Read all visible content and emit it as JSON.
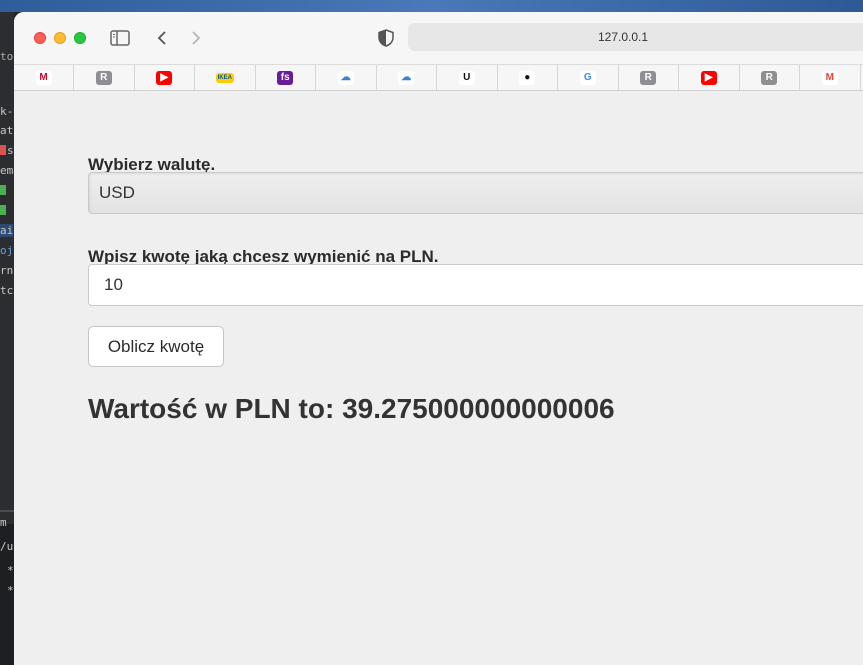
{
  "browser": {
    "address": "127.0.0.1",
    "favorites": [
      {
        "icon": "mbank-icon",
        "glyph": "M",
        "bg": "#ffffff",
        "fg": "#c8102e"
      },
      {
        "icon": "r-bookmark-icon",
        "glyph": "R",
        "bg": "#8e8e93",
        "fg": "#ffffff"
      },
      {
        "icon": "youtube-icon",
        "glyph": "▶",
        "bg": "#ff0000",
        "fg": "#ffffff"
      },
      {
        "icon": "ikea-icon",
        "glyph": "IKEA",
        "bg": "#ffcc00",
        "fg": "#0058a3"
      },
      {
        "icon": "fs-icon",
        "glyph": "fs",
        "bg": "#6a1b9a",
        "fg": "#ffffff"
      },
      {
        "icon": "cloud-face-icon",
        "glyph": "☁",
        "bg": "#ffffff",
        "fg": "#3b82d6"
      },
      {
        "icon": "cloud-face-icon-2",
        "glyph": "☁",
        "bg": "#ffffff",
        "fg": "#3b82d6"
      },
      {
        "icon": "upwork-icon",
        "glyph": "U",
        "bg": "#ffffff",
        "fg": "#111111"
      },
      {
        "icon": "github-icon",
        "glyph": "●",
        "bg": "#ffffff",
        "fg": "#111111"
      },
      {
        "icon": "google-icon",
        "glyph": "G",
        "bg": "#ffffff",
        "fg": "#4285f4"
      },
      {
        "icon": "r-bookmark-icon-2",
        "glyph": "R",
        "bg": "#8e8e93",
        "fg": "#ffffff"
      },
      {
        "icon": "youtube-icon-2",
        "glyph": "▶",
        "bg": "#ff0000",
        "fg": "#ffffff"
      },
      {
        "icon": "r-bookmark-icon-3",
        "glyph": "R",
        "bg": "#8e8e93",
        "fg": "#ffffff"
      },
      {
        "icon": "gmail-icon",
        "glyph": "M",
        "bg": "#ffffff",
        "fg": "#ea4335"
      }
    ]
  },
  "form": {
    "currency_label": "Wybierz walutę.",
    "currency_value": "USD",
    "amount_label": "Wpisz kwotę jaką chcesz wymienić na PLN.",
    "amount_value": "10",
    "submit_label": "Oblicz kwotę",
    "result_text": "Wartość w PLN to: 39.275000000000006"
  }
}
